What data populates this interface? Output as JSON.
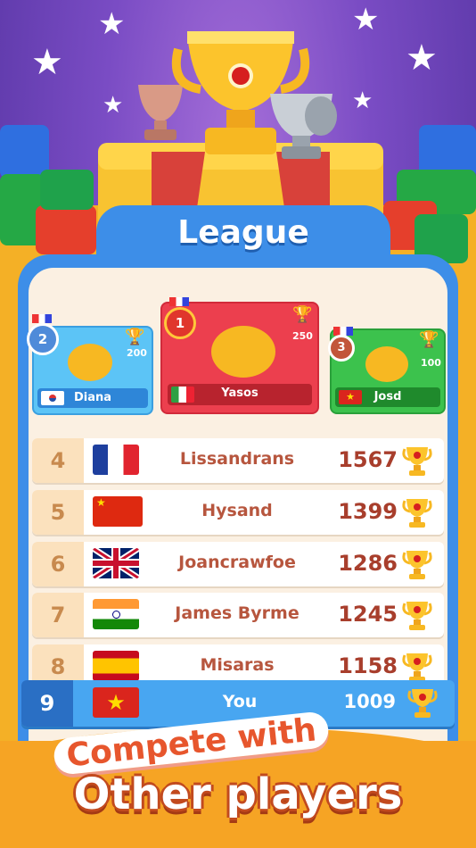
{
  "header": {
    "title": "League"
  },
  "top_three": [
    {
      "rank": "2",
      "name": "Diana",
      "prize": "200",
      "country": "KR",
      "flag_icon": "south-korea-flag"
    },
    {
      "rank": "1",
      "name": "Yasos",
      "prize": "250",
      "country": "IT",
      "flag_icon": "italy-flag"
    },
    {
      "rank": "3",
      "name": "Josd",
      "prize": "100",
      "country": "VN",
      "flag_icon": "vietnam-flag"
    }
  ],
  "leaderboard": [
    {
      "rank": "4",
      "name": "Lissandrans",
      "score": "1567",
      "flag_icon": "france-flag"
    },
    {
      "rank": "5",
      "name": "Hysand",
      "score": "1399",
      "flag_icon": "china-flag"
    },
    {
      "rank": "6",
      "name": "Joancrawfoe",
      "score": "1286",
      "flag_icon": "uk-flag"
    },
    {
      "rank": "7",
      "name": "James Byrme",
      "score": "1245",
      "flag_icon": "india-flag"
    },
    {
      "rank": "8",
      "name": "Misaras",
      "score": "1158",
      "flag_icon": "spain-flag"
    }
  ],
  "current_player": {
    "rank": "9",
    "name": "You",
    "score": "1009",
    "flag_icon": "vietnam-flag"
  },
  "promo": {
    "line1": "Compete with",
    "line2": "Other players"
  },
  "colors": {
    "panel_blue": "#3d8ee8",
    "row_rank_bg": "#fbe1bd",
    "name_color": "#b7563e",
    "score_color": "#a83e2c",
    "highlight_row": "#48a6f1"
  }
}
